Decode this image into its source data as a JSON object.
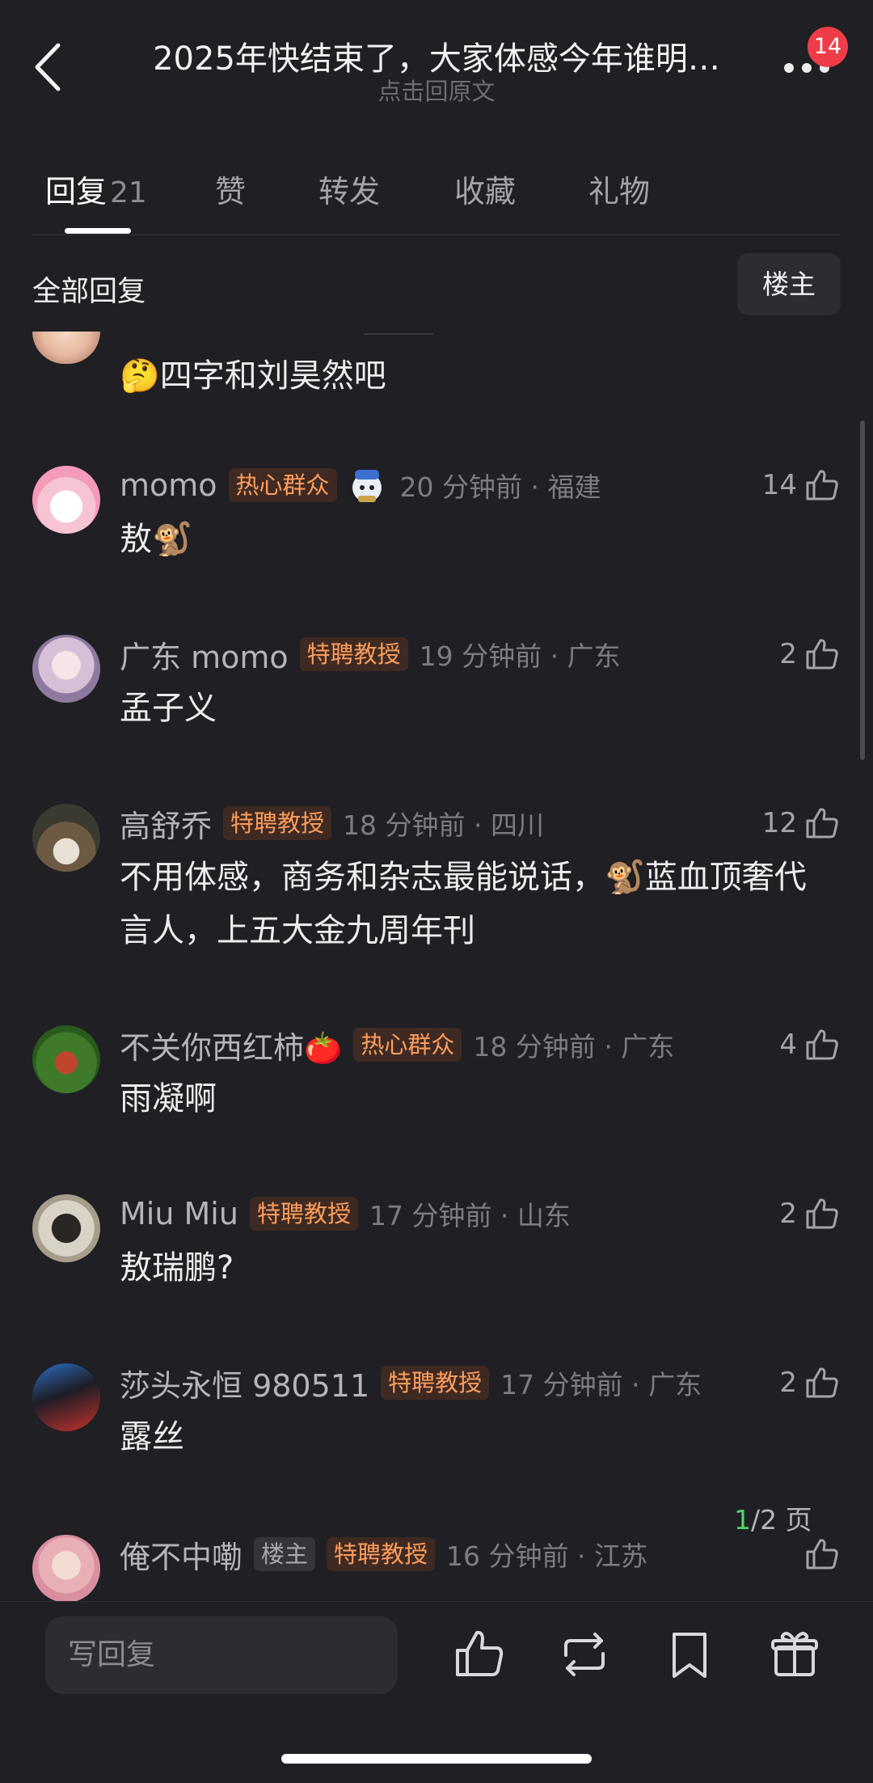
{
  "header": {
    "title": "2025年快结束了，大家体感今年谁明…",
    "subtitle": "点击回原文",
    "notification_count": "14"
  },
  "tabs": [
    {
      "label": "回复",
      "count": "21"
    },
    {
      "label": "赞"
    },
    {
      "label": "转发"
    },
    {
      "label": "收藏"
    },
    {
      "label": "礼物"
    }
  ],
  "filter": {
    "label": "全部回复",
    "owner_button": "楼主"
  },
  "partial_comment": {
    "text": "🤔四字和刘昊然吧"
  },
  "comments": [
    {
      "username": "momo",
      "badges": [
        "热心群众"
      ],
      "time": "20 分钟前 · 福建",
      "likes": "14",
      "text": "敖🐒"
    },
    {
      "username": "广东 momo",
      "badges": [
        "特聘教授"
      ],
      "time": "19 分钟前 · 广东",
      "likes": "2",
      "text": "孟子义"
    },
    {
      "username": "高舒乔",
      "badges": [
        "特聘教授"
      ],
      "time": "18 分钟前 · 四川",
      "likes": "12",
      "text": "不用体感，商务和杂志最能说话，🐒蓝血顶奢代言人，上五大金九周年刊"
    },
    {
      "username": "不关你西红柿🍅",
      "badges": [
        "热心群众"
      ],
      "time": "18 分钟前 · 广东",
      "likes": "4",
      "text": "雨凝啊"
    },
    {
      "username": "Miu Miu",
      "badges": [
        "特聘教授"
      ],
      "time": "17 分钟前 · 山东",
      "likes": "2",
      "text": "敖瑞鹏?"
    },
    {
      "username": "莎头永恒 980511",
      "badges": [
        "特聘教授"
      ],
      "time": "17 分钟前 · 广东",
      "likes": "2",
      "text": "露丝"
    },
    {
      "username": "俺不中嘞",
      "badges": [
        "楼主",
        "特聘教授"
      ],
      "time": "16 分钟前 · 江苏",
      "likes": "",
      "text": ""
    }
  ],
  "pagination": {
    "current": "1",
    "total_suffix": "/2 页"
  },
  "bottom_bar": {
    "reply_placeholder": "写回复"
  },
  "colors": {
    "background": "#1f1f24",
    "badge_text": "#ff9d5c",
    "badge_bg": "#3e2a22",
    "notification": "#ee3d48",
    "page_current": "#4fd36a"
  }
}
